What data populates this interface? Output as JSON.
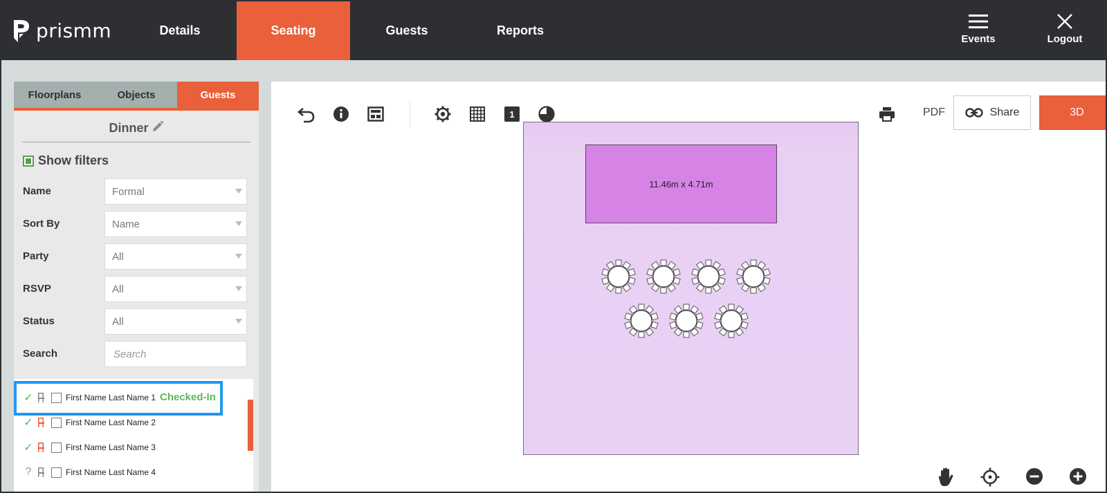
{
  "brand": {
    "name": "prismm",
    "accent": "#e9603a",
    "nav_bg": "#2d2f33"
  },
  "nav": {
    "tabs": [
      {
        "label": "Details",
        "active": false
      },
      {
        "label": "Seating",
        "active": true
      },
      {
        "label": "Guests",
        "active": false
      },
      {
        "label": "Reports",
        "active": false
      }
    ],
    "events_label": "Events",
    "logout_label": "Logout"
  },
  "sidebar": {
    "tabs": [
      {
        "label": "Floorplans",
        "active": false
      },
      {
        "label": "Objects",
        "active": false
      },
      {
        "label": "Guests",
        "active": true
      }
    ],
    "layout_name": "Dinner",
    "show_filters_label": "Show filters",
    "show_filters_checked": true,
    "filters": [
      {
        "label": "Name",
        "value": "Formal"
      },
      {
        "label": "Sort By",
        "value": "Name"
      },
      {
        "label": "Party",
        "value": "All"
      },
      {
        "label": "RSVP",
        "value": "All"
      },
      {
        "label": "Status",
        "value": "All"
      }
    ],
    "search": {
      "label": "Search",
      "placeholder": "Search",
      "value": ""
    },
    "guests": [
      {
        "name": "First Name Last Name 1",
        "status": "✓",
        "seated": false
      },
      {
        "name": "First Name Last Name 2",
        "status": "✓",
        "seated": true
      },
      {
        "name": "First Name Last Name 3",
        "status": "✓",
        "seated": true
      },
      {
        "name": "First Name Last Name 4",
        "status": "?",
        "seated": false
      }
    ],
    "checked_in_label": "Checked-In"
  },
  "toolbar": {
    "icons": [
      "undo-icon",
      "info-icon",
      "layout-icon",
      "settings-icon",
      "grid-icon",
      "layer-number-icon",
      "shading-icon"
    ],
    "layer_number": "1",
    "print_icon": "print-icon",
    "pdf_label": "PDF",
    "share_label": "Share",
    "btn_3d_label": "3D"
  },
  "floorplan": {
    "stage_label": "11.46m x 4.71m",
    "round_tables": 7
  },
  "bottom_tools": [
    "pan-hand-icon",
    "recenter-icon",
    "zoom-out-icon",
    "zoom-in-icon"
  ]
}
